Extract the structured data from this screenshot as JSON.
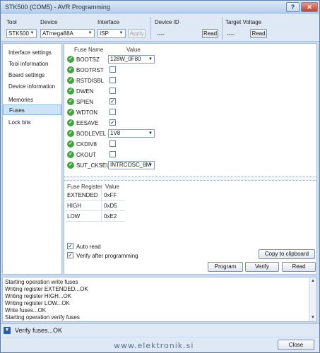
{
  "window": {
    "title": "STK500 (COM5) - AVR Programming",
    "help": "?",
    "close": "✕"
  },
  "toolbar": {
    "tool_label": "Tool",
    "tool_value": "STK500",
    "device_label": "Device",
    "device_value": "ATmega88A",
    "interface_label": "Interface",
    "interface_value": "ISP",
    "apply": "Apply",
    "device_id_label": "Device ID",
    "device_id_value": "----",
    "device_id_read": "Read",
    "target_voltage_label": "Target Voltage",
    "target_voltage_value": "----",
    "target_voltage_read": "Read"
  },
  "nav": {
    "items": [
      "Interface settings",
      "Tool information",
      "Board settings",
      "Device information",
      "Memories",
      "Fuses",
      "Lock bits"
    ],
    "selected": "Fuses"
  },
  "fuses": {
    "header_name": "Fuse Name",
    "header_value": "Value",
    "rows": [
      {
        "name": "BOOTSZ",
        "kind": "select",
        "value": "128W_0F80"
      },
      {
        "name": "BOOTRST",
        "kind": "check",
        "checked": false
      },
      {
        "name": "RSTDISBL",
        "kind": "check",
        "checked": false
      },
      {
        "name": "DWEN",
        "kind": "check",
        "checked": false
      },
      {
        "name": "SPIEN",
        "kind": "check",
        "checked": true
      },
      {
        "name": "WDTON",
        "kind": "check",
        "checked": false
      },
      {
        "name": "EESAVE",
        "kind": "check",
        "checked": true
      },
      {
        "name": "BODLEVEL",
        "kind": "select",
        "value": "1V8"
      },
      {
        "name": "CKDIV8",
        "kind": "check",
        "checked": false
      },
      {
        "name": "CKOUT",
        "kind": "check",
        "checked": false
      },
      {
        "name": "SUT_CKSEL",
        "kind": "select",
        "value": "INTRCOSC_8M"
      }
    ]
  },
  "registers": {
    "header_name": "Fuse Register",
    "header_value": "Value",
    "rows": [
      {
        "name": "EXTENDED",
        "value": "0xFF"
      },
      {
        "name": "HIGH",
        "value": "0xD5"
      },
      {
        "name": "LOW",
        "value": "0xE2"
      }
    ]
  },
  "options": {
    "auto_read": "Auto read",
    "auto_read_checked": true,
    "verify_after": "Verify after programming",
    "verify_after_checked": true
  },
  "buttons": {
    "copy": "Copy to clipboard",
    "program": "Program",
    "verify": "Verify",
    "read": "Read",
    "close": "Close"
  },
  "log": {
    "lines": [
      "Starting operation write fuses",
      "Writing register EXTENDED...OK",
      "Writing register HIGH...OK",
      "Writing register LOW...OK",
      "Write fuses...OK",
      "Starting operation verify fuses"
    ]
  },
  "status": {
    "icon": "chevron-down-icon",
    "text": "Verify fuses...OK"
  },
  "watermark": "www.elektronik.si"
}
